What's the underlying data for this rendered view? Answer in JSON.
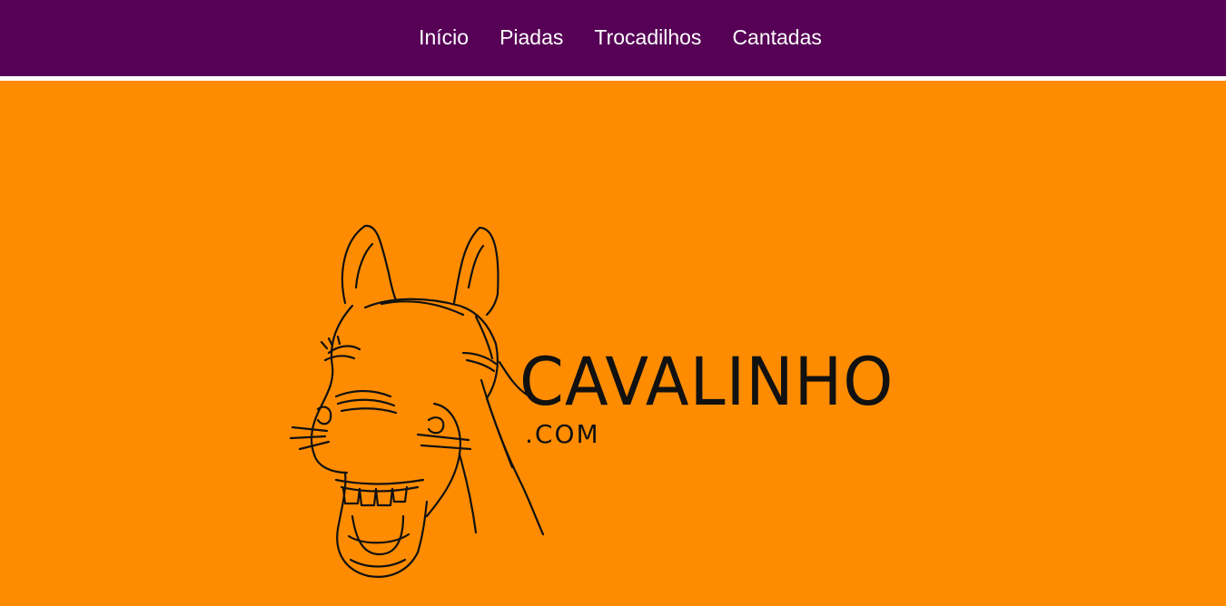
{
  "nav": {
    "items": [
      {
        "label": "Início"
      },
      {
        "label": "Piadas"
      },
      {
        "label": "Trocadilhos"
      },
      {
        "label": "Cantadas"
      }
    ]
  },
  "hero": {
    "brand_name": "CAVALINHO",
    "brand_tld": ".COM",
    "logo_icon": "laughing-horse-icon"
  },
  "colors": {
    "nav_background": "#560056",
    "nav_text": "#ffffff",
    "page_background": "#ff8c00",
    "separator": "#ffffff",
    "logo_ink": "#111111"
  }
}
